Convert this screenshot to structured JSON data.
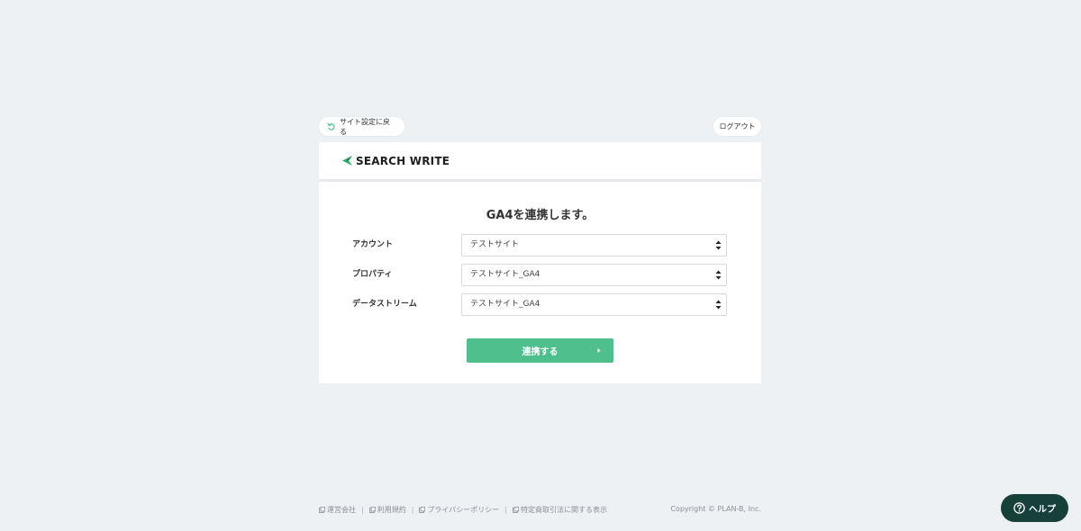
{
  "top_bar": {
    "back_label": "サイト設定に戻る",
    "logout_label": "ログアウト"
  },
  "brand": {
    "name": "SEARCH WRITE",
    "accent_color": "#4fc08d"
  },
  "card": {
    "title": "GA4を連携します。"
  },
  "form": {
    "account": {
      "label": "アカウント",
      "value": "テストサイト"
    },
    "property": {
      "label": "プロパティ",
      "value": "テストサイト_GA4"
    },
    "stream": {
      "label": "データストリーム",
      "value": "テストサイト_GA4"
    }
  },
  "submit": {
    "label": "連携する"
  },
  "footer": {
    "links": [
      "運営会社",
      "利用規約",
      "プライバシーポリシー",
      "特定商取引法に関する表示"
    ],
    "separator": "|",
    "copyright": "Copyright © PLAN-B, Inc."
  },
  "help": {
    "label": "ヘルプ"
  },
  "icons": {
    "back": "undo-arrow-icon",
    "select": "updown-arrows-icon",
    "submit": "caret-right-icon",
    "footer": "external-link-icon",
    "help": "question-circle-icon"
  }
}
